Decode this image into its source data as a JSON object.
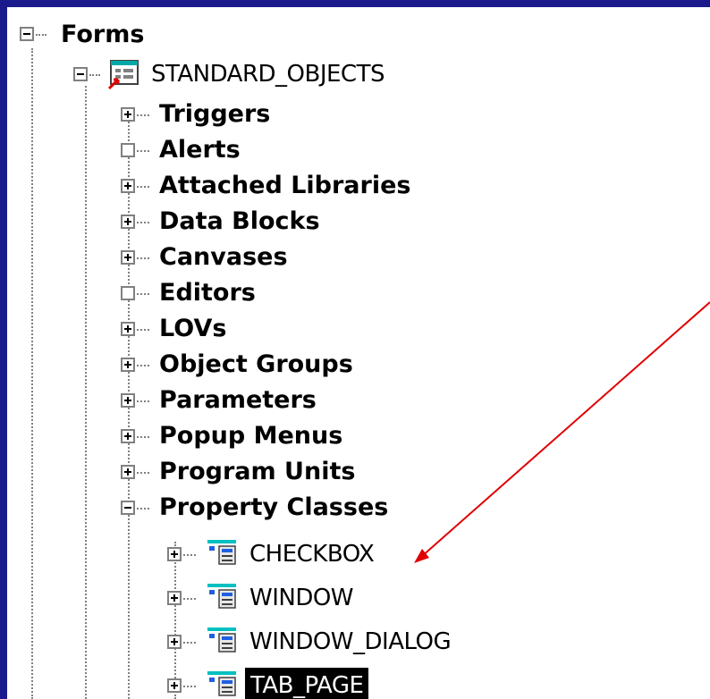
{
  "tree": {
    "root": {
      "label": "Forms",
      "state": "expanded"
    },
    "module": {
      "label": "STANDARD_OBJECTS",
      "state": "expanded",
      "icon": "form-module-icon"
    },
    "nodes": [
      {
        "label": "Triggers",
        "state": "collapsed"
      },
      {
        "label": "Alerts",
        "state": "empty"
      },
      {
        "label": "Attached Libraries",
        "state": "collapsed"
      },
      {
        "label": "Data Blocks",
        "state": "collapsed"
      },
      {
        "label": "Canvases",
        "state": "collapsed"
      },
      {
        "label": "Editors",
        "state": "empty"
      },
      {
        "label": "LOVs",
        "state": "collapsed"
      },
      {
        "label": "Object Groups",
        "state": "collapsed"
      },
      {
        "label": "Parameters",
        "state": "collapsed"
      },
      {
        "label": "Popup Menus",
        "state": "collapsed"
      },
      {
        "label": "Program Units",
        "state": "collapsed"
      },
      {
        "label": "Property Classes",
        "state": "expanded"
      }
    ],
    "property_classes": [
      {
        "label": "CHECKBOX",
        "state": "collapsed",
        "selected": false
      },
      {
        "label": "WINDOW",
        "state": "collapsed",
        "selected": false
      },
      {
        "label": "WINDOW_DIALOG",
        "state": "collapsed",
        "selected": false
      },
      {
        "label": "TAB_PAGE",
        "state": "collapsed",
        "selected": true
      }
    ]
  },
  "colors": {
    "frame": "#1a1a8c",
    "arrow": "#e00000",
    "selection_bg": "#000000"
  }
}
